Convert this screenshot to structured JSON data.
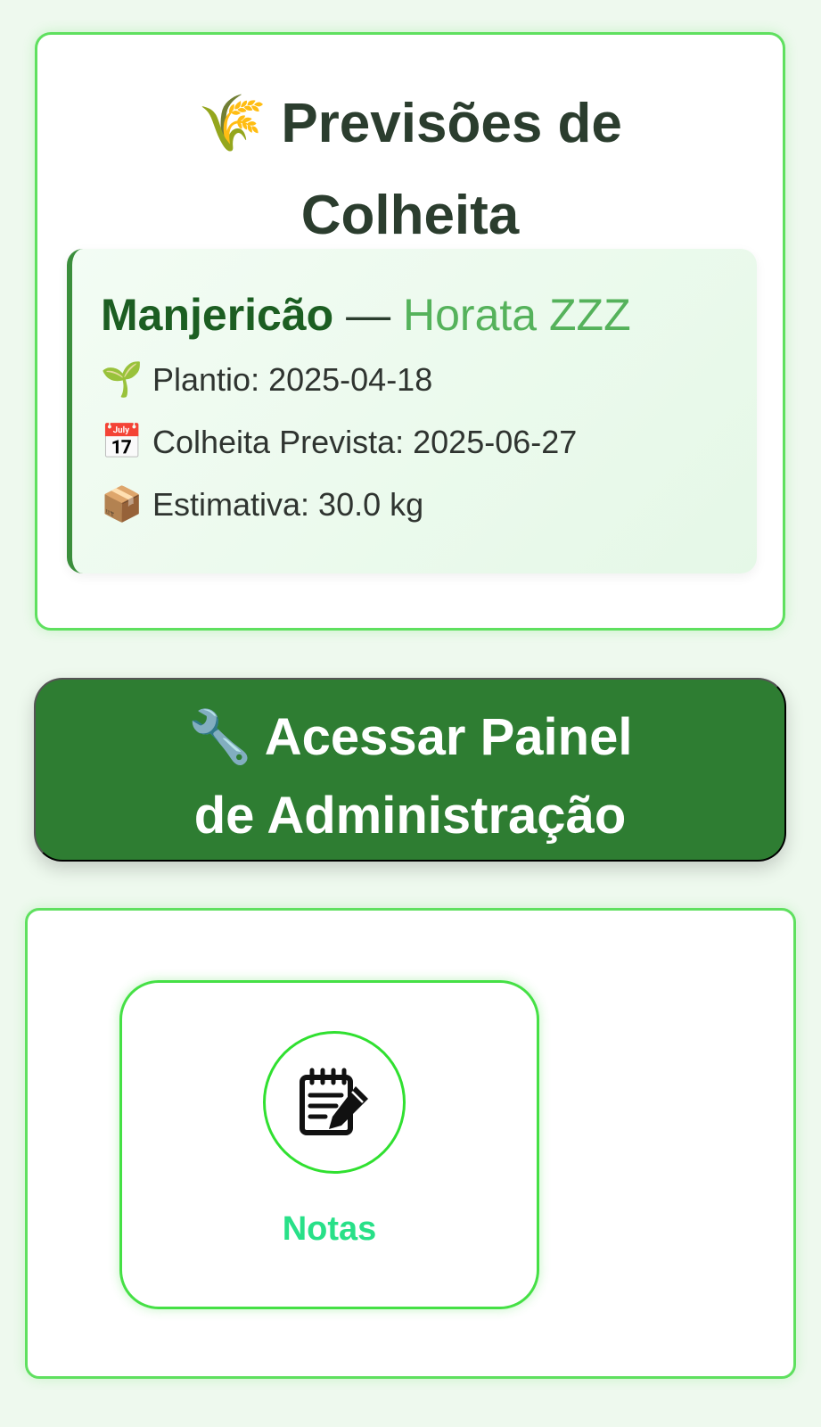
{
  "forecast": {
    "title_icon": "🌾",
    "title": "Previsões de Colheita",
    "crop": {
      "name": "Manjericão",
      "separator": " — ",
      "garden": "Horata ZZZ",
      "planting_icon": "🌱",
      "planting": "Plantio: 2025-04-18",
      "harvest_icon": "📅",
      "harvest": "Colheita Prevista: 2025-06-27",
      "estimate_icon": "📦",
      "estimate": "Estimativa: 30.0 kg"
    }
  },
  "admin": {
    "icon": "🔧",
    "label": "Acessar Painel de Administração"
  },
  "shortcuts": {
    "notes": {
      "icon": "notepad-edit-icon",
      "label": "Notas"
    }
  },
  "colors": {
    "accent_green": "#2e7d32",
    "border_green": "#5fe05f",
    "notes_label": "#28e088",
    "garden_text": "#55b25b"
  }
}
